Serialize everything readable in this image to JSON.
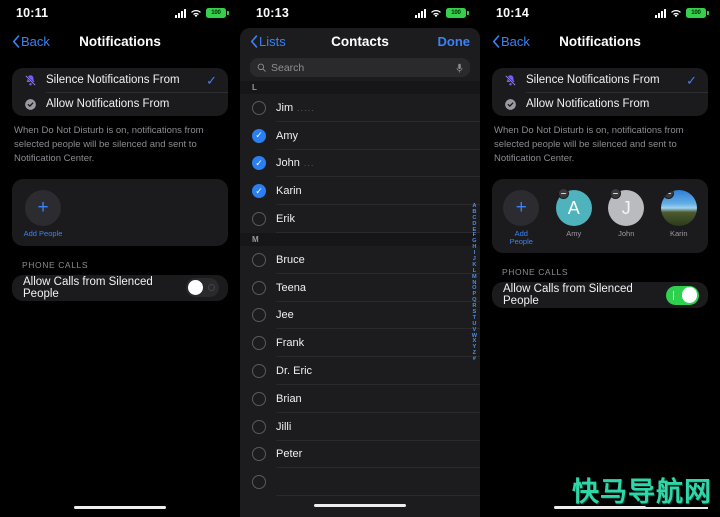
{
  "panels": [
    {
      "status": {
        "time": "10:11",
        "battery": "100",
        "signal_icon": "signal-bars-icon",
        "wifi_icon": "wifi-icon",
        "battery_icon": "battery-icon"
      },
      "nav": {
        "back_label": "Back",
        "title": "Notifications"
      },
      "options": [
        {
          "label": "Silence Notifications From",
          "icon": "bell-slash-icon",
          "checked": true
        },
        {
          "label": "Allow Notifications From",
          "icon": "badge-check-icon",
          "checked": false
        }
      ],
      "footnote": "When Do Not Disturb is on, notifications from selected people will be silenced and sent to Notification Center.",
      "people": [
        {
          "name": "Add People",
          "type": "add",
          "icon": "plus-icon"
        }
      ],
      "section_header": "PHONE CALLS",
      "toggle": {
        "label": "Allow Calls from Silenced People",
        "state": "off"
      }
    },
    {
      "status": {
        "time": "10:13",
        "battery": "100"
      },
      "nav": {
        "back_label": "Lists",
        "title": "Contacts",
        "done_label": "Done"
      },
      "search": {
        "placeholder": "Search",
        "icon": "search-icon",
        "mic_icon": "microphone-icon"
      },
      "sections": [
        {
          "header": "L",
          "contacts": [
            {
              "name": "Jim",
              "trailing": ".....",
              "selected": false
            },
            {
              "name": "Amy",
              "trailing": "",
              "selected": true
            },
            {
              "name": "John",
              "trailing": "...",
              "selected": true
            },
            {
              "name": "Karin",
              "trailing": "",
              "selected": true
            },
            {
              "name": "Erik",
              "trailing": "",
              "selected": false
            }
          ]
        },
        {
          "header": "M",
          "contacts": [
            {
              "name": "Bruce",
              "trailing": "",
              "selected": false
            },
            {
              "name": "Teena",
              "trailing": "",
              "selected": false
            },
            {
              "name": "Jee",
              "trailing": "",
              "selected": false
            },
            {
              "name": "Frank",
              "trailing": "",
              "selected": false
            },
            {
              "name": "Dr. Eric",
              "trailing": "",
              "selected": false
            },
            {
              "name": "Brian",
              "trailing": "",
              "selected": false
            },
            {
              "name": "Jilli",
              "trailing": "",
              "selected": false
            },
            {
              "name": "Peter",
              "trailing": "",
              "selected": false
            }
          ]
        }
      ],
      "alpha_index": [
        "A",
        "B",
        "C",
        "D",
        "E",
        "F",
        "G",
        "H",
        "I",
        "J",
        "K",
        "L",
        "M",
        "N",
        "O",
        "P",
        "Q",
        "R",
        "S",
        "T",
        "U",
        "V",
        "W",
        "X",
        "Y",
        "Z",
        "#"
      ]
    },
    {
      "status": {
        "time": "10:14",
        "battery": "100"
      },
      "nav": {
        "back_label": "Back",
        "title": "Notifications"
      },
      "options": [
        {
          "label": "Silence Notifications From",
          "icon": "bell-slash-icon",
          "checked": true
        },
        {
          "label": "Allow Notifications From",
          "icon": "badge-check-icon",
          "checked": false
        }
      ],
      "footnote": "When Do Not Disturb is on, notifications from selected people will be silenced and sent to Notification Center.",
      "people": [
        {
          "name": "Add People",
          "type": "add",
          "icon": "plus-icon"
        },
        {
          "name": "Amy",
          "type": "initial",
          "initial": "A",
          "color": "#4fb3bd"
        },
        {
          "name": "John",
          "type": "initial",
          "initial": "J",
          "color": "#b9bbbf"
        },
        {
          "name": "Karin",
          "type": "photo"
        }
      ],
      "section_header": "PHONE CALLS",
      "toggle": {
        "label": "Allow Calls from Silenced People",
        "state": "on"
      }
    }
  ],
  "watermark": {
    "text": "快马导航网",
    "color": "#2fd6a8"
  },
  "theme": {
    "accent_blue": "#3b82f6",
    "toggle_green": "#2fd04e",
    "select_blue": "#2b7ff0"
  }
}
